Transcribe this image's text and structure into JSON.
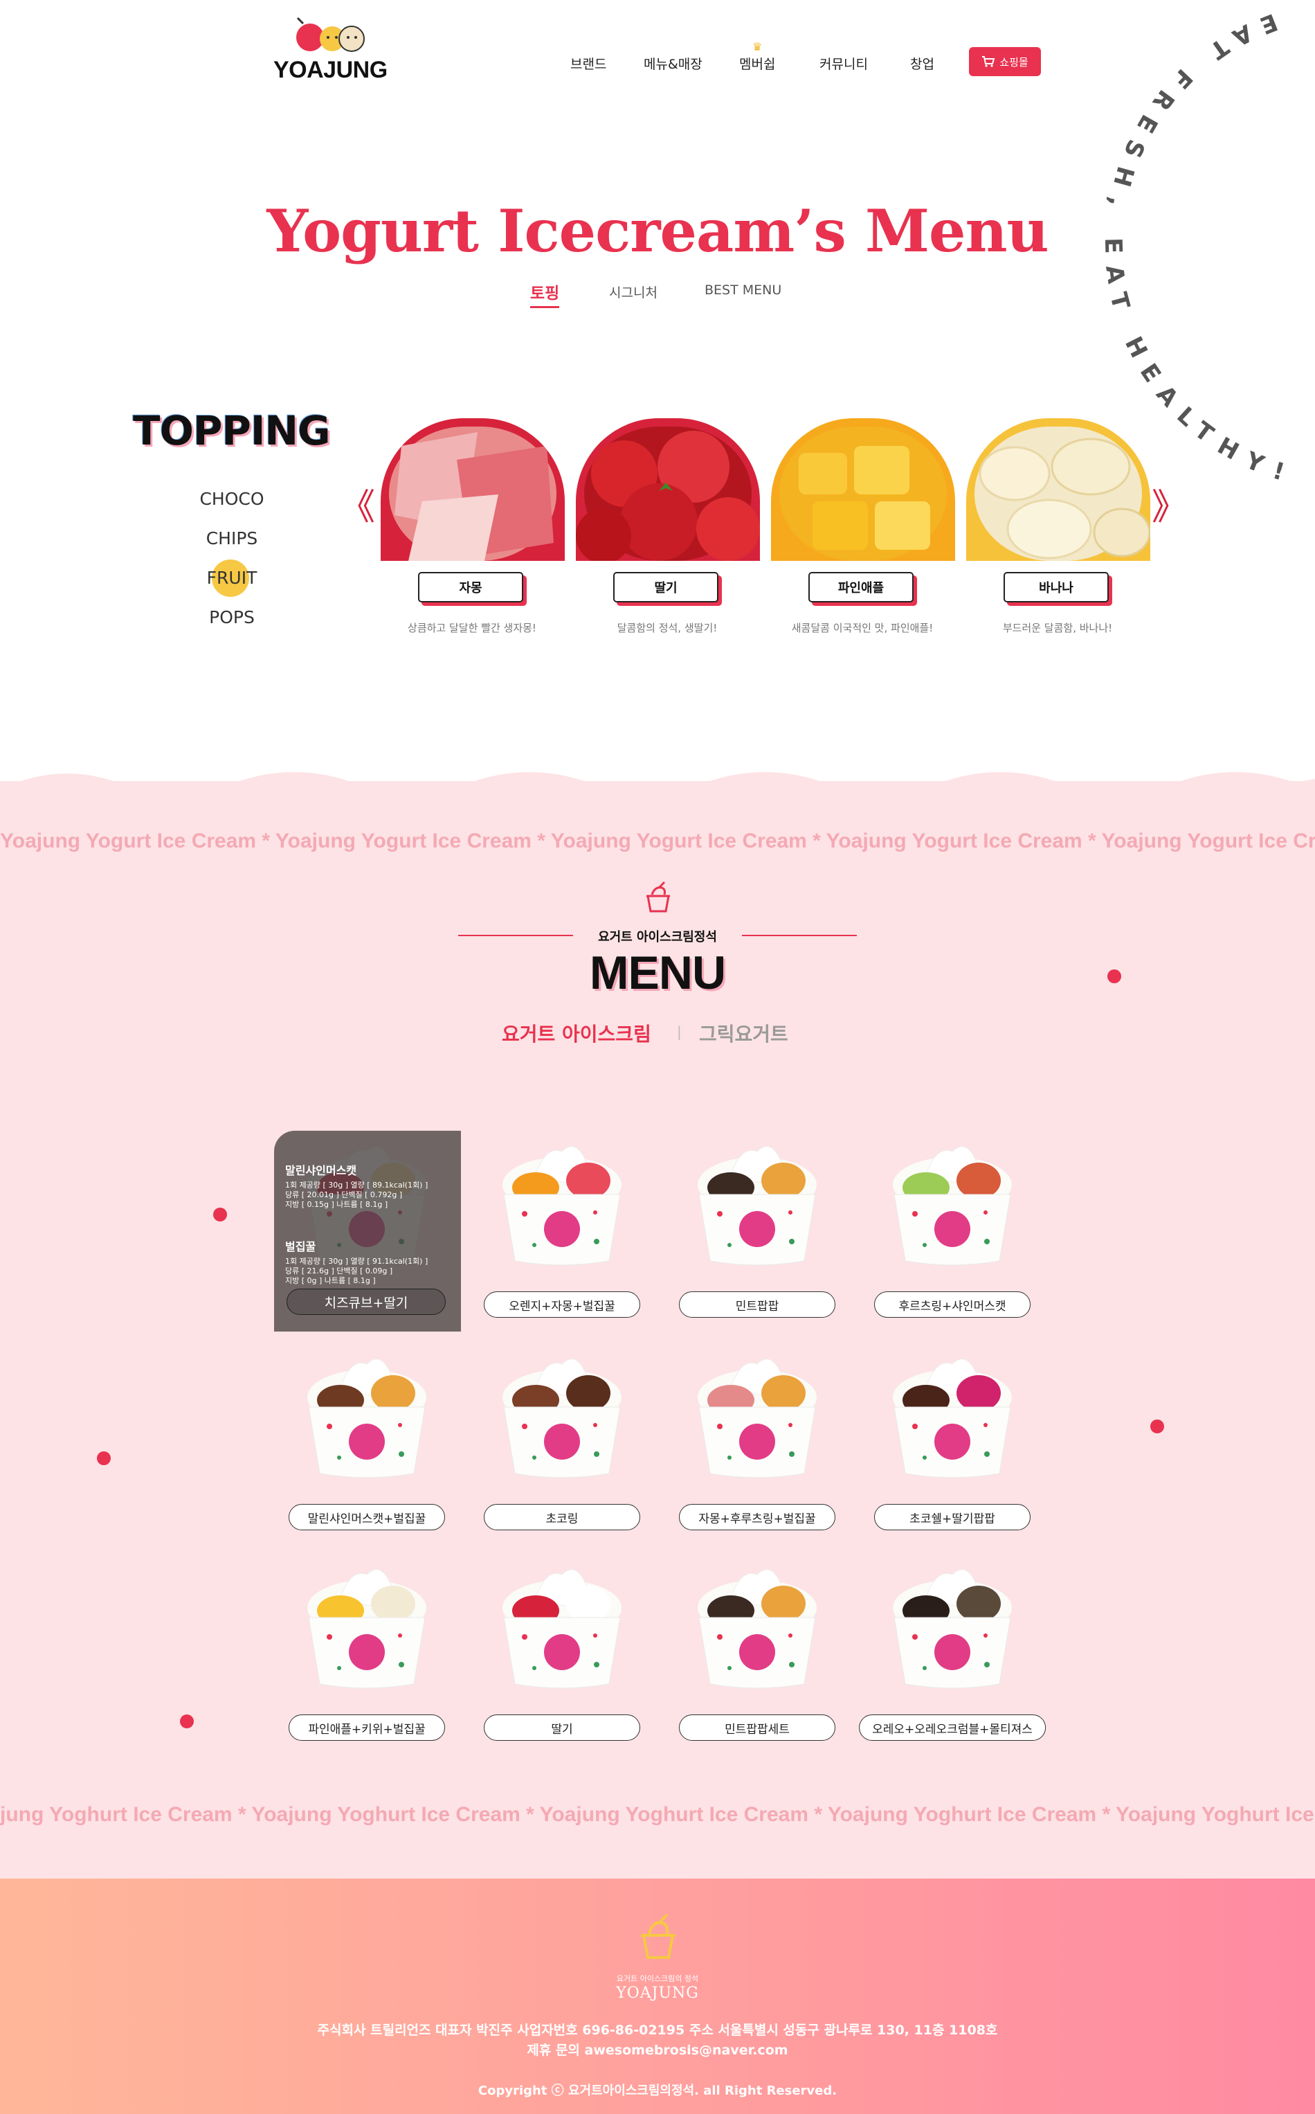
{
  "header": {
    "logo_text": "YOAJUNG",
    "nav": [
      "브랜드",
      "메뉴&매장",
      "멤버쉽",
      "커뮤니티",
      "창업"
    ],
    "shop_label": "쇼핑몰"
  },
  "circle_text": "EAT FRESH, EAT HEALTHY! ",
  "hero": {
    "title": "Yogurt Icecream’s Menu",
    "tabs": [
      "토핑",
      "시그니처",
      "BEST MENU"
    ]
  },
  "topping": {
    "heading": "TOPPING",
    "categories": [
      "CHOCO",
      "CHIPS",
      "FRUIT",
      "POPS"
    ],
    "active_category": "FRUIT",
    "prev_arrow": "《",
    "next_arrow": "》",
    "cards": [
      {
        "name": "자몽",
        "desc": "상큼하고 달달한 빨간 생자몽!"
      },
      {
        "name": "딸기",
        "desc": "달콤함의 정석, 생딸기!"
      },
      {
        "name": "파인애플",
        "desc": "새콤달콤 이국적인 맛, 파인애플!"
      },
      {
        "name": "바나나",
        "desc": "부드러운 달콤함, 바나나!"
      }
    ]
  },
  "marquee_top": "Yoajung Yogurt Ice Cream * Yoajung Yogurt Ice Cream * Yoajung Yogurt Ice Cream * Yoajung Yogurt Ice Cream * Yoajung Yogurt Ice Cream",
  "marquee_bottom": "jung Yoghurt Ice Cream * Yoajung Yoghurt Ice Cream * Yoajung Yoghurt Ice Cream * Yoajung Yoghurt Ice Cream * Yoajung Yoghurt Ice Cream * Yoajung Yoghurt",
  "menu": {
    "subtitle": "요거트 아이스크림정석",
    "title": "MENU",
    "tab_active": "요거트 아이스크림",
    "tab_other": "그릭요거트",
    "separator": "|",
    "overlay": {
      "title1": "말린샤인머스캣",
      "lines1": [
        "1회 제공량 [ 30g ]  열량 [ 89.1kcal(1회) ]",
        "당류 [ 20.01g ]  단백질 [ 0.792g ]",
        "지방 [ 0.15g ]  나트륨 [ 8.1g ]"
      ],
      "title2": "벌집꿀",
      "lines2": [
        "1회 제공량 [ 30g ]  열량 [ 91.1kcal(1회) ]",
        "당류 [ 21.6g ]  단백질 [ 0.09g ]",
        "지방 [ 0g ]  나트륨 [ 8.1g ]"
      ]
    },
    "items": [
      "치즈큐브+딸기",
      "오렌지+자몽+벌집꿀",
      "민트팝팝",
      "후르츠링+샤인머스캣",
      "말린샤인머스캣+벌집꿀",
      "초코링",
      "자몽+후루츠링+벌집꿀",
      "초코쉘+딸기팝팝",
      "파인애플+키위+벌집꿀",
      "딸기",
      "민트팝팝세트",
      "오레오+오레오크럼블+몰티져스"
    ]
  },
  "footer": {
    "logo_small": "요거트 아이스크림의 정석",
    "logo_text": "YOAJUNG",
    "line1": "주식회사 트릴리언즈  대표자 박진주   사업자번호 696-86-02195  주소 서울특별시 성동구 광나루로 130, 11층 1108호",
    "line2": "제휴 문의 awesomebrosis@naver.com",
    "copyright": "Copyright ⓒ 요거트아이스크림의정석. all Right Reserved."
  },
  "colors": {
    "accent": "#e8324f",
    "pink_bg": "#fde3e5",
    "yellow": "#f6c844"
  }
}
